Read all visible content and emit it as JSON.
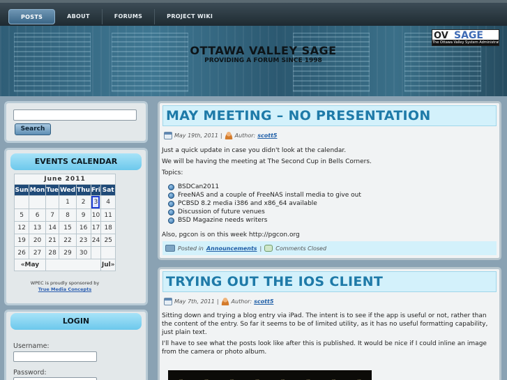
{
  "nav": {
    "items": [
      "POSTS",
      "ABOUT",
      "FORUMS",
      "PROJECT WIKI"
    ]
  },
  "header": {
    "title": "OTTAWA VALLEY SAGE",
    "tagline": "PROVIDING A FORUM SINCE 1998",
    "logo": {
      "part1": "OV",
      "part2": "SAGE",
      "strip": "The Ottawa Valley System Administrators Guild"
    }
  },
  "search": {
    "button": "Search",
    "value": ""
  },
  "calendar": {
    "title": "EVENTS CALENDAR",
    "month": "June 2011",
    "days": [
      "Sun",
      "Mon",
      "Tue",
      "Wed",
      "Thu",
      "Fri",
      "Sat"
    ],
    "weeks": [
      [
        "",
        "",
        "",
        "1",
        "2",
        "3",
        "4"
      ],
      [
        "5",
        "6",
        "7",
        "8",
        "9",
        "10",
        "11"
      ],
      [
        "12",
        "13",
        "14",
        "15",
        "16",
        "17",
        "18"
      ],
      [
        "19",
        "20",
        "21",
        "22",
        "23",
        "24",
        "25"
      ],
      [
        "26",
        "27",
        "28",
        "29",
        "30",
        "",
        ""
      ]
    ],
    "today": "3",
    "prev": "«May",
    "next": "Jul»",
    "sponsor_text": "WPEC is proudly sponsored by",
    "sponsor_link": "True Media Concepts"
  },
  "login": {
    "title": "LOGIN",
    "username_label": "Username:",
    "password_label": "Password:"
  },
  "posts": [
    {
      "title": "MAY MEETING – NO PRESENTATION",
      "date": "May 19th, 2011",
      "author_label": "Author:",
      "author": "scott5",
      "paragraphs": [
        "Just a quick update in case you didn't look at the calendar.",
        "We will be having the meeting at The Second Cup in Bells Corners.",
        "Topics:"
      ],
      "bullets": [
        "BSDCan2011",
        "FreeNAS and a couple of FreeNAS install media to give out",
        "PCBSD 8.2 media i386 and x86_64 available",
        "Discussion of future venues",
        "BSD Magazine needs writers"
      ],
      "closing": "Also, pgcon is on this week http://pgcon.org",
      "posted_in_label": "Posted in",
      "category": "Announcements",
      "comments": "Comments Closed"
    },
    {
      "title": "TRYING OUT THE IOS CLIENT",
      "date": "May 7th, 2011",
      "author_label": "Author:",
      "author": "scott5",
      "paragraphs": [
        "Sitting down and trying a blog entry via iPad. The intent is to see if the app is useful or not, rather than the content of the entry. So far it seems to be of limited utility, as it has no useful formatting capability, just plain text.",
        "I'll have to see what the posts look like after this is published. It would be nice if I could inline an image from the camera or photo album."
      ]
    }
  ],
  "colors": {
    "accent": "#1e7aa8",
    "nav_bg": "#2a3840",
    "title_bg": "#d3f1fb",
    "calendar_head": "#1f4a78"
  }
}
